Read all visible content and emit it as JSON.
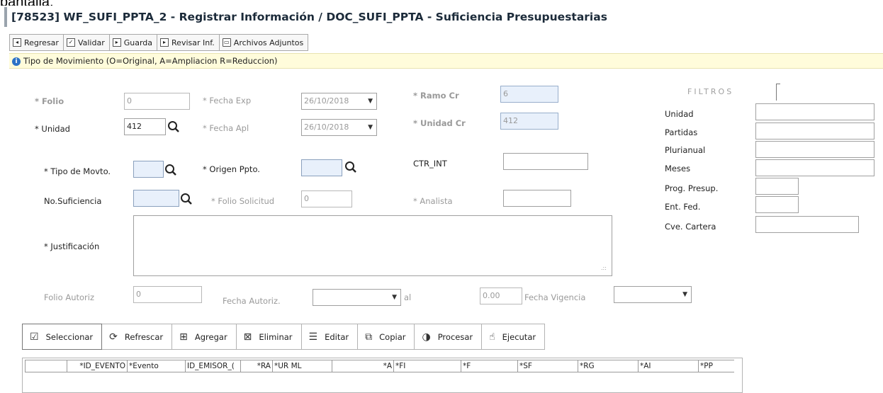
{
  "top_cut_text": "pantalla.",
  "window": {
    "title": "[78523]  WF_SUFI_PPTA_2 - Registrar Información / DOC_SUFI_PPTA - Suficiencia Presupuestarias"
  },
  "toolbar": [
    {
      "label": "Regresar",
      "icon": "back-icon"
    },
    {
      "label": "Validar",
      "icon": "check-icon"
    },
    {
      "label": "Guarda",
      "icon": "play-icon"
    },
    {
      "label": "Revisar Inf.",
      "icon": "play-icon"
    },
    {
      "label": "Archivos Adjuntos",
      "icon": "attachment-icon"
    }
  ],
  "hint": "Tipo de Movimiento (O=Original, A=Ampliacion R=Reduccion)",
  "form": {
    "folio": {
      "label": "* Folio",
      "value": "0"
    },
    "unidad": {
      "label": "* Unidad",
      "value": "412"
    },
    "fecha_exp": {
      "label": "* Fecha Exp",
      "value": "26/10/2018"
    },
    "fecha_apl": {
      "label": "* Fecha Apl",
      "value": "26/10/2018"
    },
    "ramo_cr": {
      "label": "* Ramo Cr",
      "value": "6"
    },
    "unidad_cr": {
      "label": "* Unidad Cr",
      "value": "412"
    },
    "tipo_movto": {
      "label": "* Tipo de Movto.",
      "value": ""
    },
    "origen_ppto": {
      "label": "* Origen  Ppto.",
      "value": ""
    },
    "ctr_int": {
      "label": "CTR_INT",
      "value": ""
    },
    "no_suficiencia": {
      "label": "No.Suficiencia",
      "value": ""
    },
    "folio_solicitud": {
      "label": "* Folio Solicitud",
      "value": "0"
    },
    "analista": {
      "label": "* Analista",
      "value": ""
    },
    "justificacion": {
      "label": "* Justificación",
      "value": ""
    },
    "folio_autoriz": {
      "label": "Folio Autoriz",
      "value": "0"
    },
    "fecha_autoriz": {
      "label": "Fecha Autoriz.",
      "value": ""
    },
    "al_label": "al",
    "monto": {
      "value": "0.00"
    },
    "fecha_vigencia": {
      "label": "Fecha Vigencia",
      "value": ""
    }
  },
  "filtros": {
    "title": "FILTROS",
    "items": [
      {
        "label": "Unidad",
        "value": ""
      },
      {
        "label": "Partidas",
        "value": ""
      },
      {
        "label": "Plurianual",
        "value": ""
      },
      {
        "label": "Meses",
        "value": ""
      },
      {
        "label": "Prog. Presup.",
        "value": ""
      },
      {
        "label": "Ent. Fed.",
        "value": ""
      },
      {
        "label": "Cve. Cartera",
        "value": ""
      }
    ]
  },
  "actions": [
    {
      "label": "Seleccionar",
      "icon": "checkbox-icon"
    },
    {
      "label": "Refrescar",
      "icon": "refresh-icon"
    },
    {
      "label": "Agregar",
      "icon": "plus-icon"
    },
    {
      "label": "Eliminar",
      "icon": "x-icon"
    },
    {
      "label": "Editar",
      "icon": "edit-icon"
    },
    {
      "label": "Copiar",
      "icon": "copy-icon"
    },
    {
      "label": "Procesar",
      "icon": "process-icon"
    },
    {
      "label": "Ejecutar",
      "icon": "execute-icon"
    }
  ],
  "grid": {
    "columns": [
      "",
      "*ID_EVENTO",
      "*Evento",
      "ID_EMISOR_(",
      "*RA",
      "*UR ML",
      "*A",
      "*FI",
      "*F",
      "*SF",
      "*RG",
      "*AI",
      "*PP"
    ]
  }
}
